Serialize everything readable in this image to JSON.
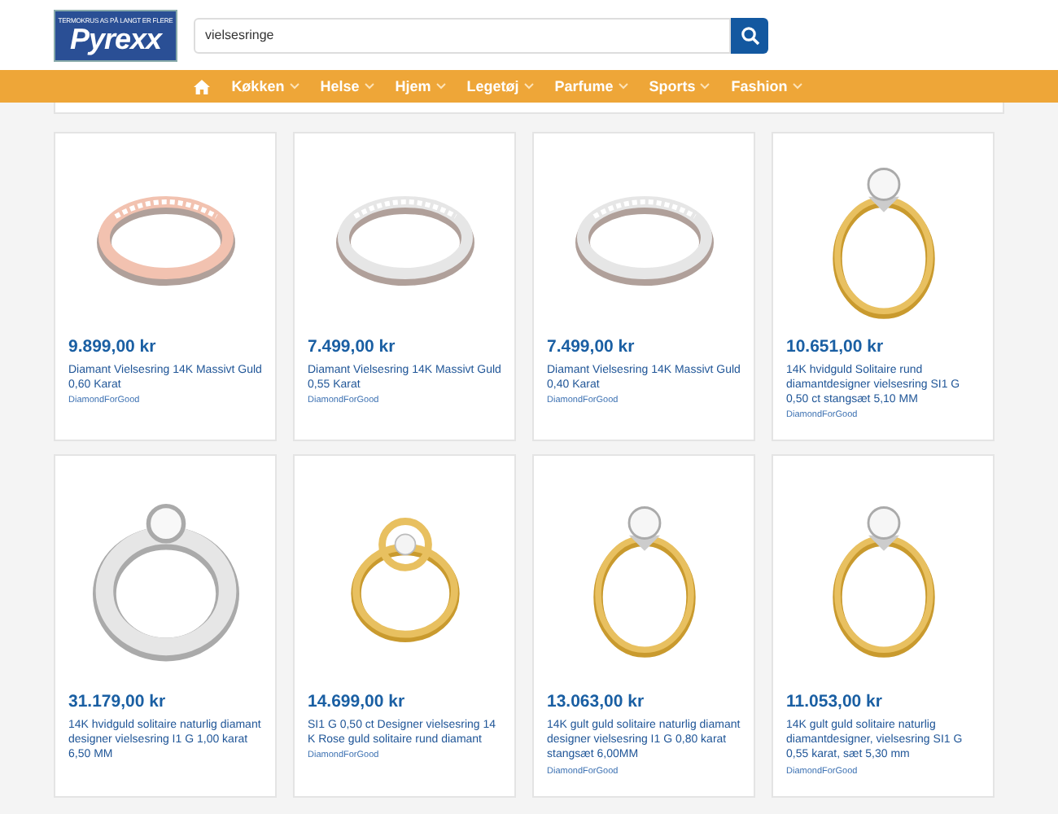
{
  "header": {
    "logo": {
      "tagline": "TERMOKRUS AS PÅ LANGT ER FLERE",
      "name": "Pyrexx"
    },
    "search": {
      "value": "vielsesringe"
    }
  },
  "nav": {
    "items": [
      {
        "label": "Køkken",
        "dropdown": true
      },
      {
        "label": "Helse",
        "dropdown": true
      },
      {
        "label": "Hjem",
        "dropdown": true
      },
      {
        "label": "Legetøj",
        "dropdown": true
      },
      {
        "label": "Parfume",
        "dropdown": true
      },
      {
        "label": "Sports",
        "dropdown": true
      },
      {
        "label": "Fashion",
        "dropdown": true
      }
    ]
  },
  "products": [
    {
      "kind": "band",
      "color": "#f2c2b0",
      "price": "9.899,00 kr",
      "title": "Diamant Vielsesring 14K Massivt Guld 0,60 Karat",
      "brand": "DiamondForGood"
    },
    {
      "kind": "band",
      "color": "#e6e6e6",
      "price": "7.499,00 kr",
      "title": "Diamant Vielsesring 14K Massivt Guld 0,55 Karat",
      "brand": "DiamondForGood"
    },
    {
      "kind": "band",
      "color": "#e6e6e6",
      "price": "7.499,00 kr",
      "title": "Diamant Vielsesring 14K Massivt Guld 0,40 Karat",
      "brand": "DiamondForGood"
    },
    {
      "kind": "solitaire",
      "color": "#e8c060",
      "price": "10.651,00 kr",
      "title": "14K hvidguld Solitaire rund diamantdesigner vielsesring SI1 G 0,50 ct stangsæt 5,10 MM",
      "brand": "DiamondForGood"
    },
    {
      "kind": "wide",
      "color": "#e6e6e6",
      "price": "31.179,00 kr",
      "title": "14K hvidguld solitaire naturlig diamant designer vielsesring I1 G 1,00 karat 6,50 MM"
    },
    {
      "kind": "knot",
      "color": "#e8c060",
      "price": "14.699,00 kr",
      "title": "SI1 G 0,50 ct Designer vielsesring 14 K Rose guld solitaire rund diamant",
      "brand": "DiamondForGood"
    },
    {
      "kind": "solitaire",
      "color": "#e8c060",
      "price": "13.063,00 kr",
      "title": "14K gult guld solitaire naturlig diamant designer vielsesring I1 G 0,80 karat stangsæt 6,00MM",
      "brand": "DiamondForGood"
    },
    {
      "kind": "solitaire",
      "color": "#e8c060",
      "price": "11.053,00 kr",
      "title": "14K gult guld solitaire naturlig diamantdesigner, vielsesring SI1 G 0,55 karat, sæt 5,30 mm",
      "brand": "DiamondForGood"
    }
  ]
}
